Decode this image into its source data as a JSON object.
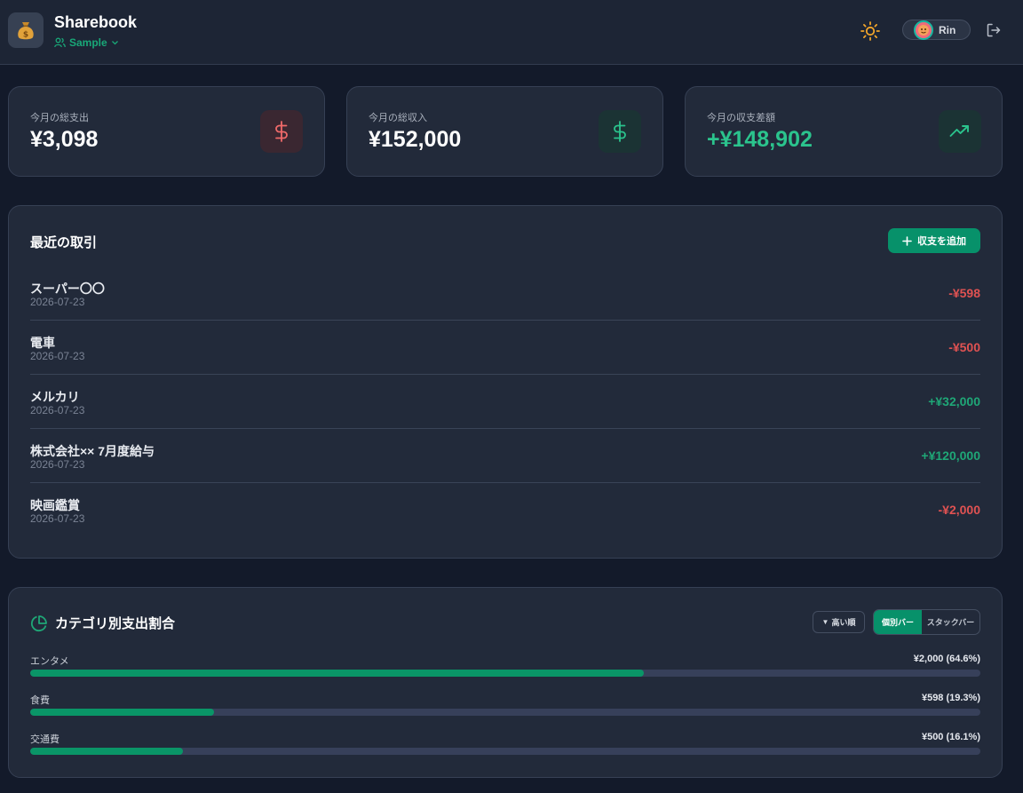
{
  "header": {
    "title": "Sharebook",
    "workspace": "Sample",
    "user_name": "Rin",
    "icons": {
      "app": "money-bag-icon",
      "workspace": "users-icon",
      "theme": "sun-icon",
      "logout": "logout-icon"
    }
  },
  "stats": [
    {
      "label": "今月の総支出",
      "value": "¥3,098",
      "icon": "dollar-icon",
      "accent": "#f06a6a"
    },
    {
      "label": "今月の総収入",
      "value": "¥152,000",
      "icon": "dollar-icon",
      "accent": "#2bc48d"
    },
    {
      "label": "今月の収支差額",
      "value": "+¥148,902",
      "icon": "trending-up-icon",
      "accent": "#2bc48d"
    }
  ],
  "transactions": {
    "title": "最近の取引",
    "add_label": "収支を追加",
    "items": [
      {
        "name": "スーパー〇〇",
        "date": "2026-07-23",
        "amount": "-¥598",
        "type": "expense"
      },
      {
        "name": "電車",
        "date": "2026-07-23",
        "amount": "-¥500",
        "type": "expense"
      },
      {
        "name": "メルカリ",
        "date": "2026-07-23",
        "amount": "+¥32,000",
        "type": "income"
      },
      {
        "name": "株式会社×× 7月度給与",
        "date": "2026-07-23",
        "amount": "+¥120,000",
        "type": "income"
      },
      {
        "name": "映画鑑賞",
        "date": "2026-07-23",
        "amount": "-¥2,000",
        "type": "expense"
      }
    ]
  },
  "categories": {
    "title": "カテゴリ別支出割合",
    "sort_label": "高い順",
    "view_options": [
      "個別バー",
      "スタックバー"
    ],
    "active_view": "個別バー",
    "items": [
      {
        "label": "エンタメ",
        "amount": "¥2,000 (64.6%)",
        "percent": 64.6
      },
      {
        "label": "食費",
        "amount": "¥598 (19.3%)",
        "percent": 19.3
      },
      {
        "label": "交通費",
        "amount": "¥500 (16.1%)",
        "percent": 16.1
      }
    ]
  },
  "colors": {
    "accent": "#07916a",
    "income": "#1fa777",
    "expense": "#e05252"
  }
}
